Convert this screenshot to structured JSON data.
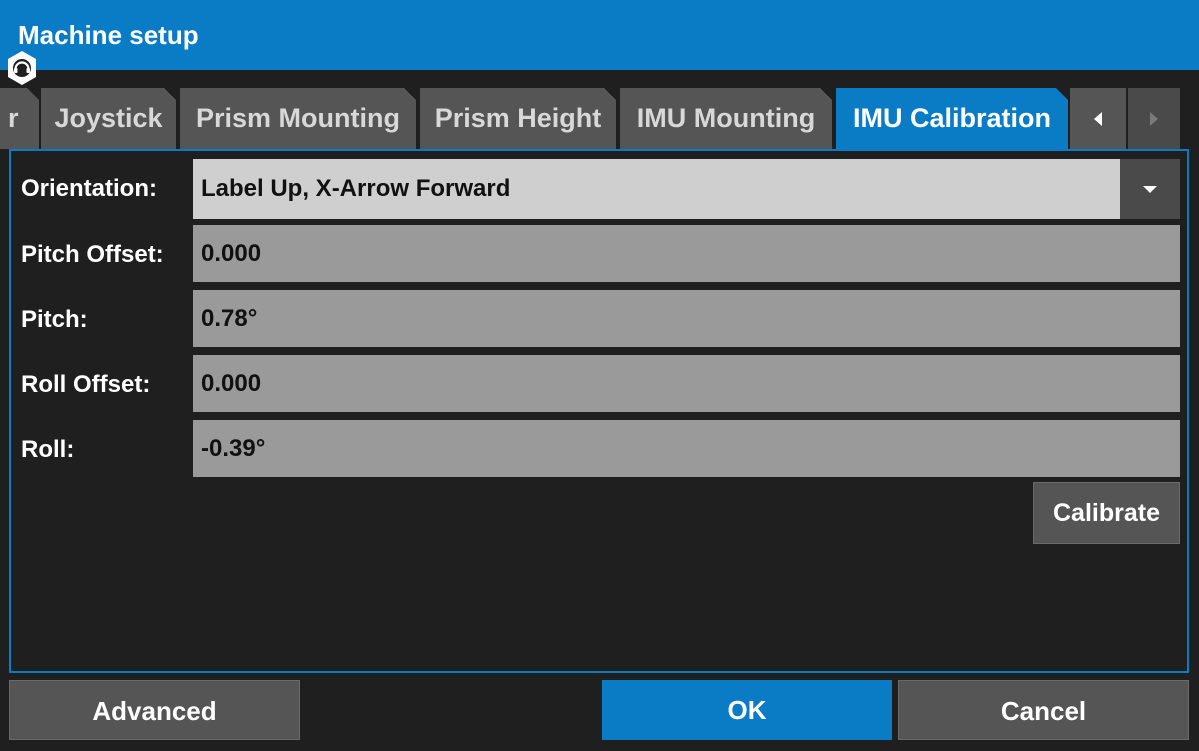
{
  "window": {
    "title": "Machine setup"
  },
  "colors": {
    "accent": "#0a7cc6",
    "tab_inactive": "#555555",
    "field_readonly": "#9a9a9a",
    "field_select": "#cfcfcf",
    "background": "#1f1f1f"
  },
  "tabs": [
    {
      "label": "r",
      "active": false
    },
    {
      "label": "Joystick",
      "active": false
    },
    {
      "label": "Prism Mounting",
      "active": false
    },
    {
      "label": "Prism Height",
      "active": false
    },
    {
      "label": "IMU Mounting",
      "active": false
    },
    {
      "label": "IMU Calibration",
      "active": true
    }
  ],
  "tab_scroll": {
    "left_icon": "caret-left-icon",
    "right_icon": "caret-right-icon"
  },
  "form": {
    "orientation": {
      "label": "Orientation:",
      "value": "Label Up, X-Arrow Forward",
      "icon": "caret-down-icon"
    },
    "pitch_offset": {
      "label": "Pitch Offset:",
      "value": "0.000"
    },
    "pitch": {
      "label": "Pitch:",
      "value": "0.78°"
    },
    "roll_offset": {
      "label": "Roll Offset:",
      "value": "0.000"
    },
    "roll": {
      "label": "Roll:",
      "value": "-0.39°"
    }
  },
  "actions": {
    "calibrate": "Calibrate",
    "advanced": "Advanced",
    "ok": "OK",
    "cancel": "Cancel"
  },
  "badge_icon": "headset-support-icon"
}
